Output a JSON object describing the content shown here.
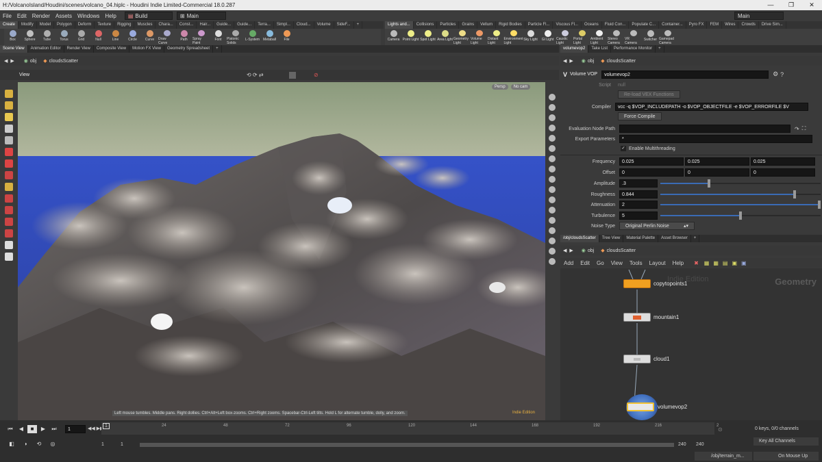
{
  "window": {
    "title": "H:/VolcanoIsland/Houdini/scenes/volcano_04.hiplc - Houdini Indie Limited-Commercial 18.0.287",
    "controls": [
      "—",
      "❐",
      "✕"
    ]
  },
  "menu": {
    "items": [
      "File",
      "Edit",
      "Render",
      "Assets",
      "Windows",
      "Help"
    ],
    "desktop": "Build",
    "desktop2": "Main",
    "right_desktop": "Main"
  },
  "shelf_tabs_left": [
    "Create",
    "Modify",
    "Model",
    "Polygon",
    "Deform",
    "Texture",
    "Rigging",
    "Muscles",
    "Chara...",
    "Const...",
    "Hair...",
    "Guide...",
    "Guide...",
    "Terra...",
    "Simpl...",
    "Cloud...",
    "Volume",
    "SideF..."
  ],
  "shelf_tabs_right": [
    "Lights and...",
    "Collisions",
    "Particles",
    "Grains",
    "Vellum",
    "Rigid Bodies",
    "Particle Fl...",
    "Viscous Fl...",
    "Oceans",
    "Fluid Con...",
    "Populate C...",
    "Container...",
    "Pyro FX",
    "FEM",
    "Wires",
    "Crowds",
    "Drive Sim..."
  ],
  "tools_left": [
    {
      "label": "Box",
      "color": "#9aa9c9"
    },
    {
      "label": "Sphere",
      "color": "#c0c0c0"
    },
    {
      "label": "Tube",
      "color": "#b0b0b0"
    },
    {
      "label": "Torus",
      "color": "#9ab"
    },
    {
      "label": "Grid",
      "color": "#aaa"
    },
    {
      "label": "Null",
      "color": "#d66"
    },
    {
      "label": "Line",
      "color": "#c84"
    },
    {
      "label": "Circle",
      "color": "#9ad"
    },
    {
      "label": "Curve",
      "color": "#d96"
    },
    {
      "label": "Draw Curve",
      "color": "#aac"
    },
    {
      "label": "Path",
      "color": "#c8a"
    },
    {
      "label": "Spray Paint",
      "color": "#c9c"
    },
    {
      "label": "Font",
      "color": "#ddd"
    },
    {
      "label": "Platonic Solids",
      "color": "#aaa"
    },
    {
      "label": "L-System",
      "color": "#6a6"
    },
    {
      "label": "Metaball",
      "color": "#8bd"
    },
    {
      "label": "File",
      "color": "#e95"
    }
  ],
  "tools_right": [
    {
      "label": "Camera",
      "color": "#bbb"
    },
    {
      "label": "Point Light",
      "color": "#ee8"
    },
    {
      "label": "Spot Light",
      "color": "#ee8"
    },
    {
      "label": "Area Light",
      "color": "#dd8"
    },
    {
      "label": "Geometry Light",
      "color": "#ed8"
    },
    {
      "label": "Volume Light",
      "color": "#e96"
    },
    {
      "label": "Distant Light",
      "color": "#ee8"
    },
    {
      "label": "Environment Light",
      "color": "#fd6"
    },
    {
      "label": "Sky Light",
      "color": "#ddd"
    },
    {
      "label": "GI Light",
      "color": "#eee"
    },
    {
      "label": "Caustic Light",
      "color": "#ccd"
    },
    {
      "label": "Portal Light",
      "color": "#dc6"
    },
    {
      "label": "Ambient Light",
      "color": "#eee"
    },
    {
      "label": "Stereo Camera",
      "color": "#bbb"
    },
    {
      "label": "VR Camera",
      "color": "#bbb"
    },
    {
      "label": "Switcher",
      "color": "#bbb"
    },
    {
      "label": "Gamepad Camera",
      "color": "#bbb"
    }
  ],
  "left_panetabs": [
    "Scene View",
    "Animation Editor",
    "Render View",
    "Composite View",
    "Motion FX View",
    "Geometry Spreadsheet"
  ],
  "left_path": {
    "root": "obj",
    "node": "cloudsScatter"
  },
  "viewport": {
    "title": "View",
    "persp": "Persp",
    "nocam": "No cam",
    "status": "Left mouse tumbles. Middle pans. Right dollies. Ctrl+Alt+Left box-zooms. Ctrl+Right zooms. Spacebar-Ctrl-Left tilts. Hold L for alternate tumble, dolly, and zoom.",
    "watermark": "Indie Edition"
  },
  "right_top_tabs": [
    "volumevop2",
    "Take List",
    "Performance Monitor"
  ],
  "param_path": {
    "root": "obj",
    "node": "cloudsScatter"
  },
  "params": {
    "node_type": "Volume VOP",
    "node_name": "volumevop2",
    "script_label": "Script",
    "script_value": "null",
    "reload_btn": "Re-load VEX Functions",
    "compiler_label": "Compiler",
    "compiler_value": "vcc -q $VOP_INCLUDEPATH -o $VOP_OBJECTFILE -e $VOP_ERRORFILE $V",
    "force_compile": "Force Compile",
    "eval_label": "Evaluation Node Path",
    "export_label": "Export Parameters",
    "export_value": "*",
    "multithread_label": "Enable Multithreading",
    "frequency_label": "Frequency",
    "frequency": [
      "0.025",
      "0.025",
      "0.025"
    ],
    "offset_label": "Offset",
    "offset": [
      "0",
      "0",
      "0"
    ],
    "amplitude_label": "Amplitude",
    "amplitude": ".3",
    "amplitude_frac": 0.3,
    "roughness_label": "Roughness",
    "roughness": "0.844",
    "roughness_frac": 0.844,
    "attenuation_label": "Attenuation",
    "attenuation": "2",
    "attenuation_frac": 1.0,
    "turbulence_label": "Turbulence",
    "turbulence": "5",
    "turbulence_frac": 0.5,
    "noisetype_label": "Noise Type",
    "noisetype": "Original Perlin Noise"
  },
  "net_tabs": [
    "/obj/cloudsScatter",
    "Tree View",
    "Material Palette",
    "Asset Browser"
  ],
  "net_path": {
    "root": "obj",
    "node": "cloudsScatter"
  },
  "net_menu": [
    "Add",
    "Edit",
    "Go",
    "View",
    "Tools",
    "Layout",
    "Help"
  ],
  "net_overlay": {
    "context": "Geometry",
    "watermark": "Indie Edition"
  },
  "nodes": [
    {
      "name": "copytopoints1",
      "color": "#f0a020"
    },
    {
      "name": "mountain1",
      "color": "#dcdcdc"
    },
    {
      "name": "cloud1",
      "color": "#dcdcdc"
    },
    {
      "name": "volumevop2",
      "color": "#dcdcdc"
    }
  ],
  "timeline": {
    "frame": "1",
    "start": "1",
    "start2": "1",
    "end": "240",
    "end2": "240",
    "current_marker": "1",
    "ticks": [
      "24",
      "48",
      "72",
      "96",
      "120",
      "144",
      "168",
      "192",
      "216",
      "2"
    ],
    "keys": "0 keys, 0/0 channels",
    "key_all": "Key All Channels",
    "status_path": "/obj/terrain_m...",
    "update_mode": "On Mouse Up"
  }
}
